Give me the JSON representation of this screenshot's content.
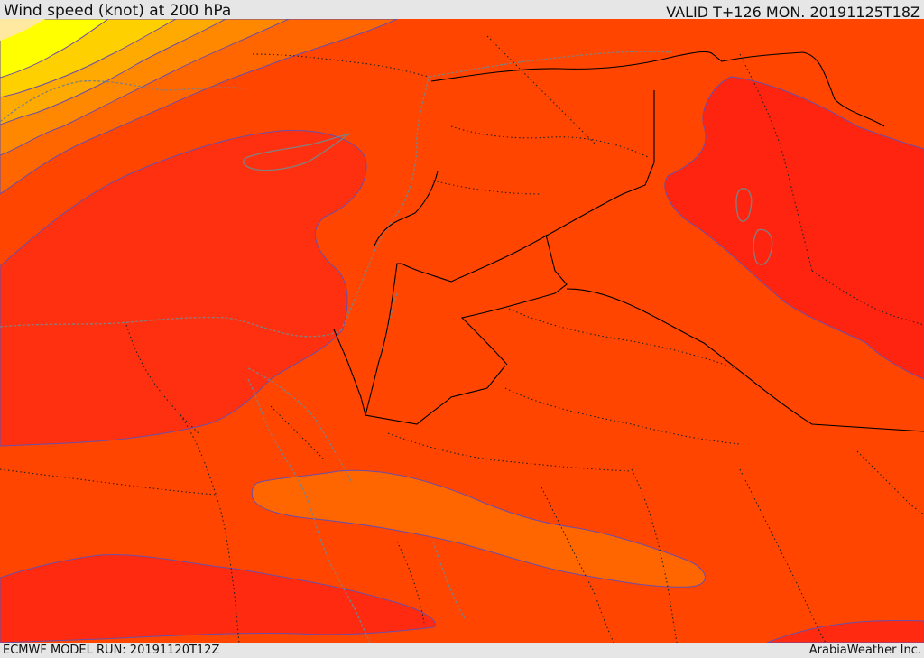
{
  "header": {
    "title": "Wind speed (knot) at 200 hPa",
    "valid_time": "VALID T+126 MON. 20191125T18Z"
  },
  "footer": {
    "model_run": "ECMWF MODEL RUN: 20191120T12Z",
    "credit": "ArabiaWeather Inc."
  },
  "map": {
    "field": "wind speed at 200 hPa",
    "colors": {
      "core_yellow": "#ffff00",
      "light_orange": "#ffd000",
      "orange_1": "#ffaa00",
      "orange_2": "#ff8800",
      "orange_3": "#ff6600",
      "orange_4": "#ff4f00",
      "base": "#ff4500",
      "red_1": "#ff3010",
      "red_2": "#ff2410",
      "contour_line": "#6a4ea8",
      "coastline": "#808080",
      "border": "#000000"
    }
  }
}
